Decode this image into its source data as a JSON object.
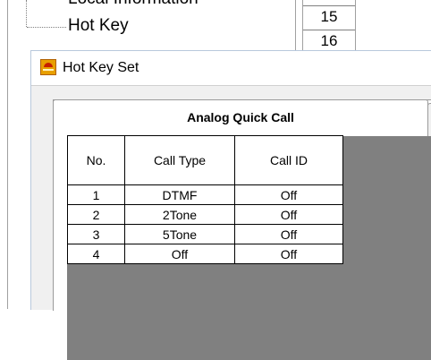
{
  "background_tree": {
    "clipped_item": "Local Information",
    "hot_key_item": "Hot Key"
  },
  "background_numbers": [
    "15",
    "16"
  ],
  "dialog": {
    "title": "Hot Key Set",
    "tab_label": "Analog Quick Call"
  },
  "grid": {
    "headers": {
      "no": "No.",
      "call_type": "Call Type",
      "call_id": "Call ID"
    },
    "rows": [
      {
        "no": "1",
        "call_type": "DTMF",
        "call_id": "Off"
      },
      {
        "no": "2",
        "call_type": "2Tone",
        "call_id": "Off"
      },
      {
        "no": "3",
        "call_type": "5Tone",
        "call_id": "Off"
      },
      {
        "no": "4",
        "call_type": "Off",
        "call_id": "Off"
      }
    ]
  },
  "icons": {
    "app_icon": "radio-app-icon"
  },
  "colors": {
    "dialog_bg": "#f0f0f0",
    "grid_empty_area": "#808080",
    "app_icon": "#e8a000"
  }
}
